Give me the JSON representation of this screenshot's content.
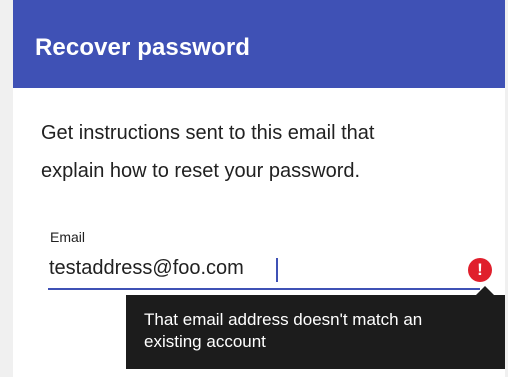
{
  "app_bar": {
    "title": "Recover password",
    "color": "#3f51b5"
  },
  "instructions": {
    "line1": "Get instructions sent to this email that",
    "line2": "explain how to reset your password."
  },
  "email_field": {
    "label": "Email",
    "value": "testaddress@foo.com",
    "error_icon": "error-exclamation-icon",
    "error_color": "#e01f2c",
    "error_message_line1": "That email address doesn't match an",
    "error_message_line2": "existing account"
  }
}
